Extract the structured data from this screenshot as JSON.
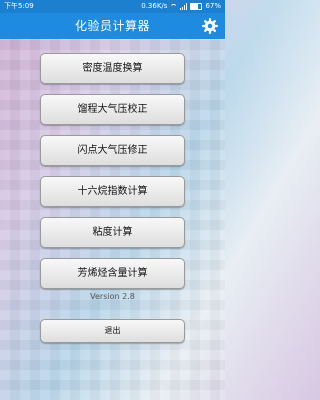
{
  "status_bar": {
    "time": "下午5:09",
    "network_speed": "0.36K/s",
    "battery_percent": "67%"
  },
  "app_bar": {
    "title": "化验员计算器",
    "settings_icon": "gear-icon"
  },
  "menu": {
    "items": [
      {
        "label": "密度温度换算"
      },
      {
        "label": "馏程大气压校正"
      },
      {
        "label": "闪点大气压修正"
      },
      {
        "label": "十六烷指数计算"
      },
      {
        "label": "粘度计算"
      },
      {
        "label": "芳烯烃含量计算"
      }
    ]
  },
  "version_text": "Version 2.8",
  "exit_label": "退出",
  "colors": {
    "status_bar": "#1c7fd0",
    "app_bar": "#1f8be0"
  }
}
